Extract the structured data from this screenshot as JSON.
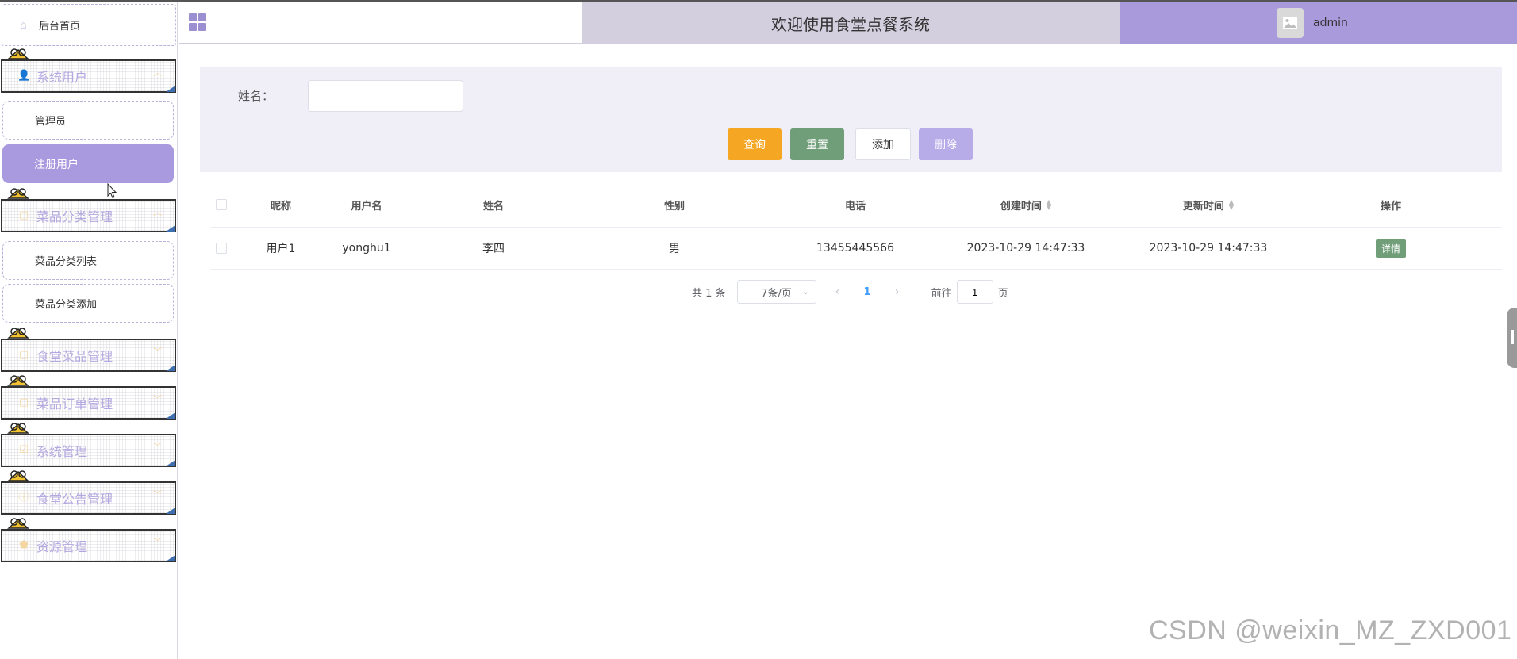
{
  "header": {
    "title": "欢迎使用食堂点餐系统",
    "username": "admin"
  },
  "sidebar": {
    "home": "后台首页",
    "groups": [
      {
        "label": "系统用户",
        "items": [
          "管理员",
          "注册用户"
        ]
      },
      {
        "label": "菜品分类管理",
        "items": [
          "菜品分类列表",
          "菜品分类添加"
        ]
      },
      {
        "label": "食堂菜品管理",
        "items": []
      },
      {
        "label": "菜品订单管理",
        "items": []
      },
      {
        "label": "系统管理",
        "items": []
      },
      {
        "label": "食堂公告管理",
        "items": []
      },
      {
        "label": "资源管理",
        "items": []
      }
    ],
    "active_item": "注册用户"
  },
  "search": {
    "name_label": "姓名：",
    "name_value": "",
    "buttons": {
      "query": "查询",
      "reset": "重置",
      "add": "添加",
      "delete": "删除"
    }
  },
  "table": {
    "columns": [
      "昵称",
      "用户名",
      "姓名",
      "性别",
      "电话",
      "创建时间",
      "更新时间",
      "操作"
    ],
    "rows": [
      {
        "nickname": "用户1",
        "username": "yonghu1",
        "name": "李四",
        "gender": "男",
        "phone": "13455445566",
        "created": "2023-10-29 14:47:33",
        "updated": "2023-10-29 14:47:33",
        "action": "详情"
      }
    ]
  },
  "pagination": {
    "total": "共 1 条",
    "page_size": "7条/页",
    "current_page": "1",
    "goto_prefix": "前往",
    "goto_value": "1",
    "goto_suffix": "页"
  },
  "watermark": "CSDN @weixin_MZ_ZXD001",
  "colors": {
    "accent": "#a999de",
    "header_mid": "#d4cfdf",
    "header_right": "#a99adc",
    "query": "#f5a623",
    "reset": "#6f9e78",
    "delete": "#b8ace8"
  }
}
